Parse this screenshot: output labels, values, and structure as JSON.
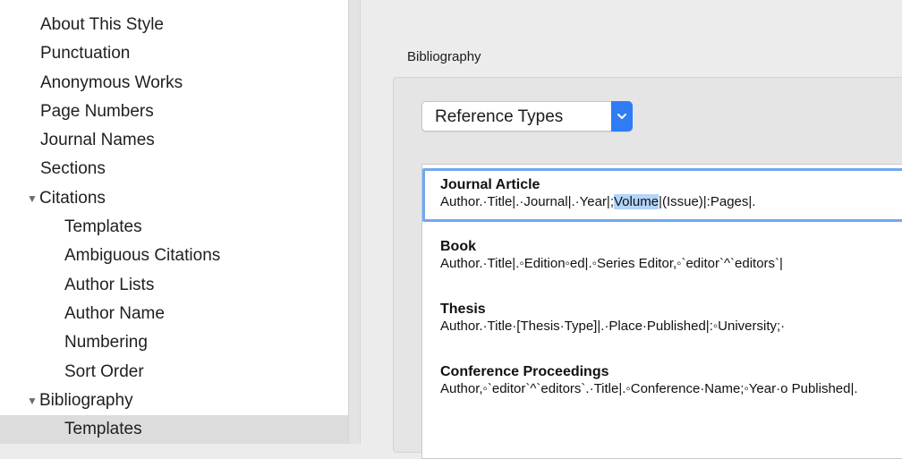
{
  "sidebar": {
    "items": [
      {
        "label": "About This Style",
        "level": 0
      },
      {
        "label": "Punctuation",
        "level": 0
      },
      {
        "label": "Anonymous Works",
        "level": 0
      },
      {
        "label": "Page Numbers",
        "level": 0
      },
      {
        "label": "Journal Names",
        "level": 0
      },
      {
        "label": "Sections",
        "level": 0
      },
      {
        "label": "Citations",
        "level": 0,
        "expanded": true
      },
      {
        "label": "Templates",
        "level": 1
      },
      {
        "label": "Ambiguous Citations",
        "level": 1
      },
      {
        "label": "Author Lists",
        "level": 1
      },
      {
        "label": "Author Name",
        "level": 1
      },
      {
        "label": "Numbering",
        "level": 1
      },
      {
        "label": "Sort Order",
        "level": 1
      },
      {
        "label": "Bibliography",
        "level": 0,
        "expanded": true
      },
      {
        "label": "Templates",
        "level": 1,
        "selected": true
      }
    ]
  },
  "main": {
    "section_label": "Bibliography",
    "reference_types_label": "Reference Types",
    "templates": [
      {
        "name": "Journal Article",
        "pre": "Author.·Title|.·Journal|.·Year|;",
        "selected_text": "Volume",
        "post": "|(Issue)|:Pages|."
      },
      {
        "name": "Book",
        "body": "Author.·Title|.◦Edition◦ed|.◦Series Editor,◦`editor`^`editors`|"
      },
      {
        "name": "Thesis",
        "body": "Author.·Title·[Thesis·Type]|.·Place·Published|:◦University;·"
      },
      {
        "name": "Conference Proceedings",
        "body": "Author,◦`editor`^`editors`.·Title|.◦Conference·Name;◦Year·o Published|."
      }
    ]
  },
  "colors": {
    "accent": "#2f7cf6",
    "selection_highlight": "#b3d4fb",
    "focus_ring": "#6fa8f0"
  }
}
